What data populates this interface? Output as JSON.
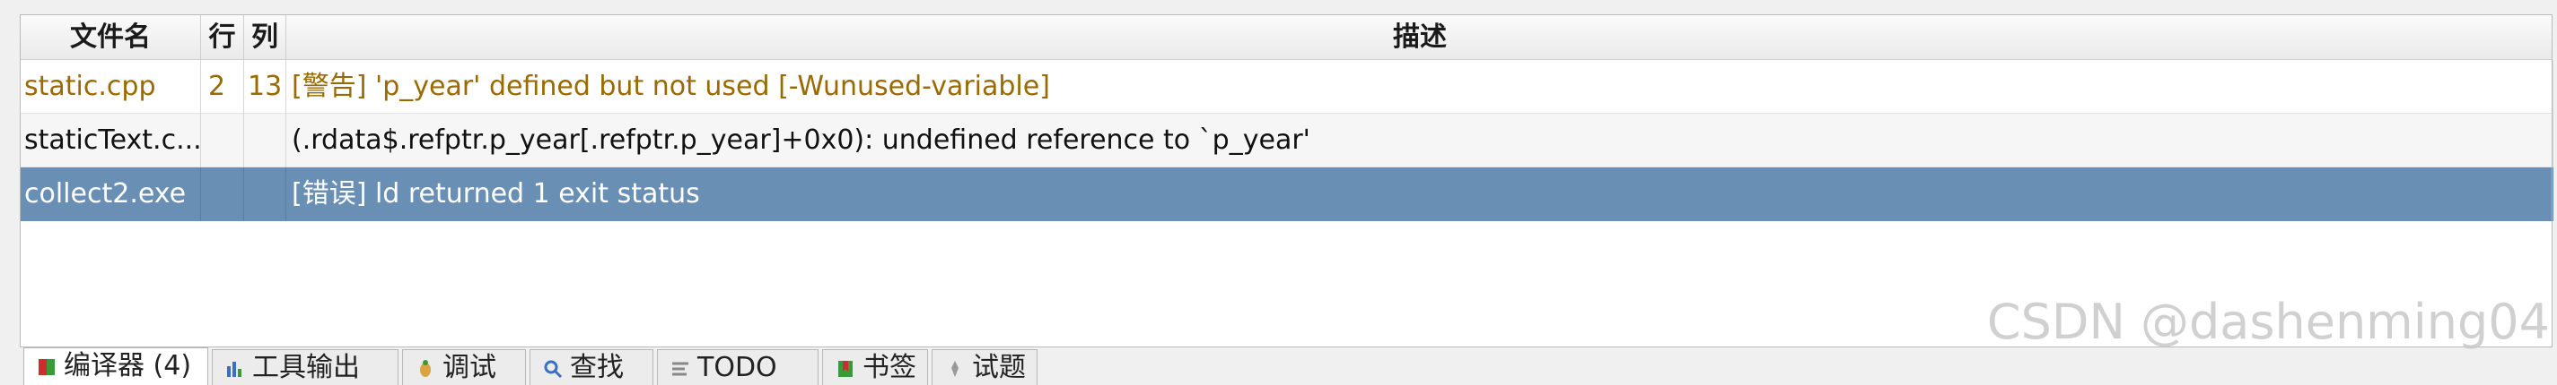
{
  "columns": {
    "file": "文件名",
    "line": "行",
    "col": "列",
    "desc": "描述"
  },
  "rows": [
    {
      "file": "static.cpp",
      "line": "2",
      "col": "13",
      "desc": "[警告] 'p_year' defined but not used [-Wunused-variable]",
      "kind": "warning"
    },
    {
      "file": "staticText.c...",
      "line": "",
      "col": "",
      "desc": "(.rdata$.refptr.p_year[.refptr.p_year]+0x0): undefined reference to `p_year'",
      "kind": "normal"
    },
    {
      "file": "collect2.exe",
      "line": "",
      "col": "",
      "desc": "[错误] ld returned 1 exit status",
      "kind": "selected"
    }
  ],
  "tabs": [
    {
      "label": "编译器 (4)",
      "icon": "compiler-icon",
      "active": true
    },
    {
      "label": "工具输出",
      "icon": "tool-output-icon",
      "active": false
    },
    {
      "label": "调试",
      "icon": "debug-icon",
      "active": false
    },
    {
      "label": "查找",
      "icon": "search-icon",
      "active": false
    },
    {
      "label": "TODO",
      "icon": "todo-icon",
      "active": false
    },
    {
      "label": "书签",
      "icon": "bookmark-icon",
      "active": false
    },
    {
      "label": "试题",
      "icon": "problem-icon",
      "active": false
    }
  ],
  "watermark": "CSDN @dashenming04",
  "colors": {
    "warning_text": "#9a6a00",
    "selected_bg": "#6a8fb5",
    "selected_text": "#ffffff"
  }
}
